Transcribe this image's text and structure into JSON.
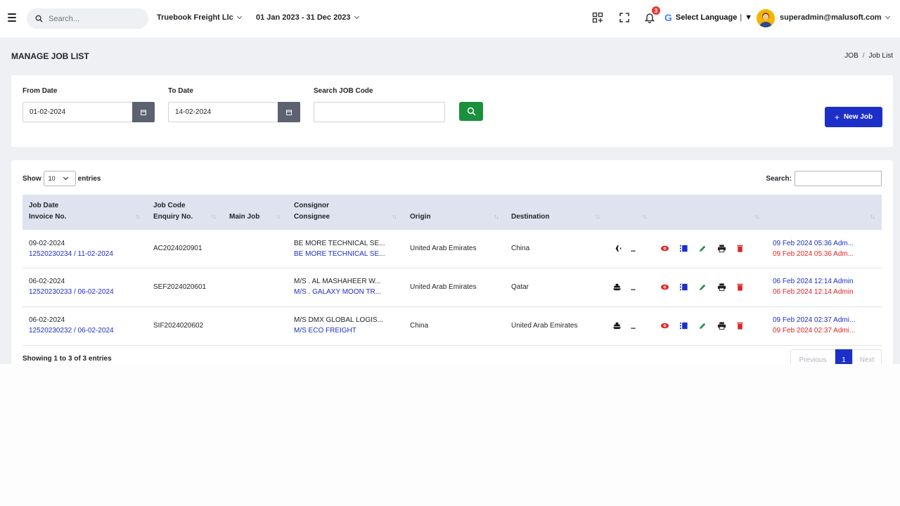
{
  "topbar": {
    "search_placeholder": "Search...",
    "company": "Truebook Freight Llc",
    "date_range": "01 Jan 2023 - 31 Dec 2023",
    "notification_count": "3",
    "language_label": "Select Language",
    "language_arrow": "▼",
    "user_email": "superadmin@malusoft.com"
  },
  "page": {
    "title": "MANAGE JOB LIST",
    "breadcrumb": [
      "JOB",
      "Job List"
    ]
  },
  "filters": {
    "from_label": "From Date",
    "from_value": "01-02-2024",
    "to_label": "To Date",
    "to_value": "14-02-2024",
    "code_label": "Search JOB Code",
    "code_value": "",
    "new_job_label": "New Job"
  },
  "table": {
    "show_label": "Show",
    "show_value": "10",
    "entries_label": "entries",
    "search_label": "Search:",
    "headers": {
      "job_date": "Job Date",
      "invoice_no": "Invoice No.",
      "job_code": "Job Code",
      "enquiry_no": "Enquiry No.",
      "main_job": "Main Job",
      "consignor": "Consignor",
      "consignee": "Consignee",
      "origin": "Origin",
      "destination": "Destination"
    },
    "rows": [
      {
        "job_date": "09-02-2024",
        "invoice": "12520230234 / 11-02-2024",
        "job_code": "AC2024020901",
        "main_job": "",
        "consignor": "BE MORE TECHNICAL SE...",
        "consignee": "BE MORE TECHNICAL SE...",
        "origin": "United Arab Emirates",
        "destination": "China",
        "mode": "air",
        "created": "09 Feb 2024 05:36 Adm...",
        "updated": "09 Feb 2024 05:36 Adm..."
      },
      {
        "job_date": "06-02-2024",
        "invoice": "12520230233 / 06-02-2024",
        "job_code": "SEF2024020601",
        "main_job": "",
        "consignor": "M/S . AL MASHAHEER W...",
        "consignee": "M/S . GALAXY MOON TR...",
        "origin": "United Arab Emirates",
        "destination": "Qatar",
        "mode": "sea",
        "created": "06 Feb 2024 12:14 Admin",
        "updated": "06 Feb 2024 12:14 Admin"
      },
      {
        "job_date": "06-02-2024",
        "invoice": "12520230232 / 06-02-2024",
        "job_code": "SIF2024020602",
        "main_job": "",
        "consignor": "M/S DMX GLOBAL LOGIS...",
        "consignee": "M/S ECO FREIGHT",
        "origin": "China",
        "destination": "United Arab Emirates",
        "mode": "sea",
        "created": "09 Feb 2024 02:37 Admi...",
        "updated": "09 Feb 2024 02:37 Admi..."
      }
    ],
    "info": "Showing 1 to 3 of 3 entries",
    "pagination": {
      "previous": "Previous",
      "current": "1",
      "next": "Next"
    }
  },
  "colors": {
    "primary": "#1d2fc9",
    "success": "#1a8f3c",
    "danger": "#e02424",
    "header_bg": "#dfe3ef"
  },
  "icons": [
    "menu-icon",
    "search-icon",
    "apps-icon",
    "fullscreen-icon",
    "bell-icon",
    "calendar-icon",
    "airplane-icon",
    "ship-icon",
    "more-icon",
    "view-icon",
    "list-icon",
    "edit-icon",
    "print-icon",
    "delete-icon"
  ]
}
